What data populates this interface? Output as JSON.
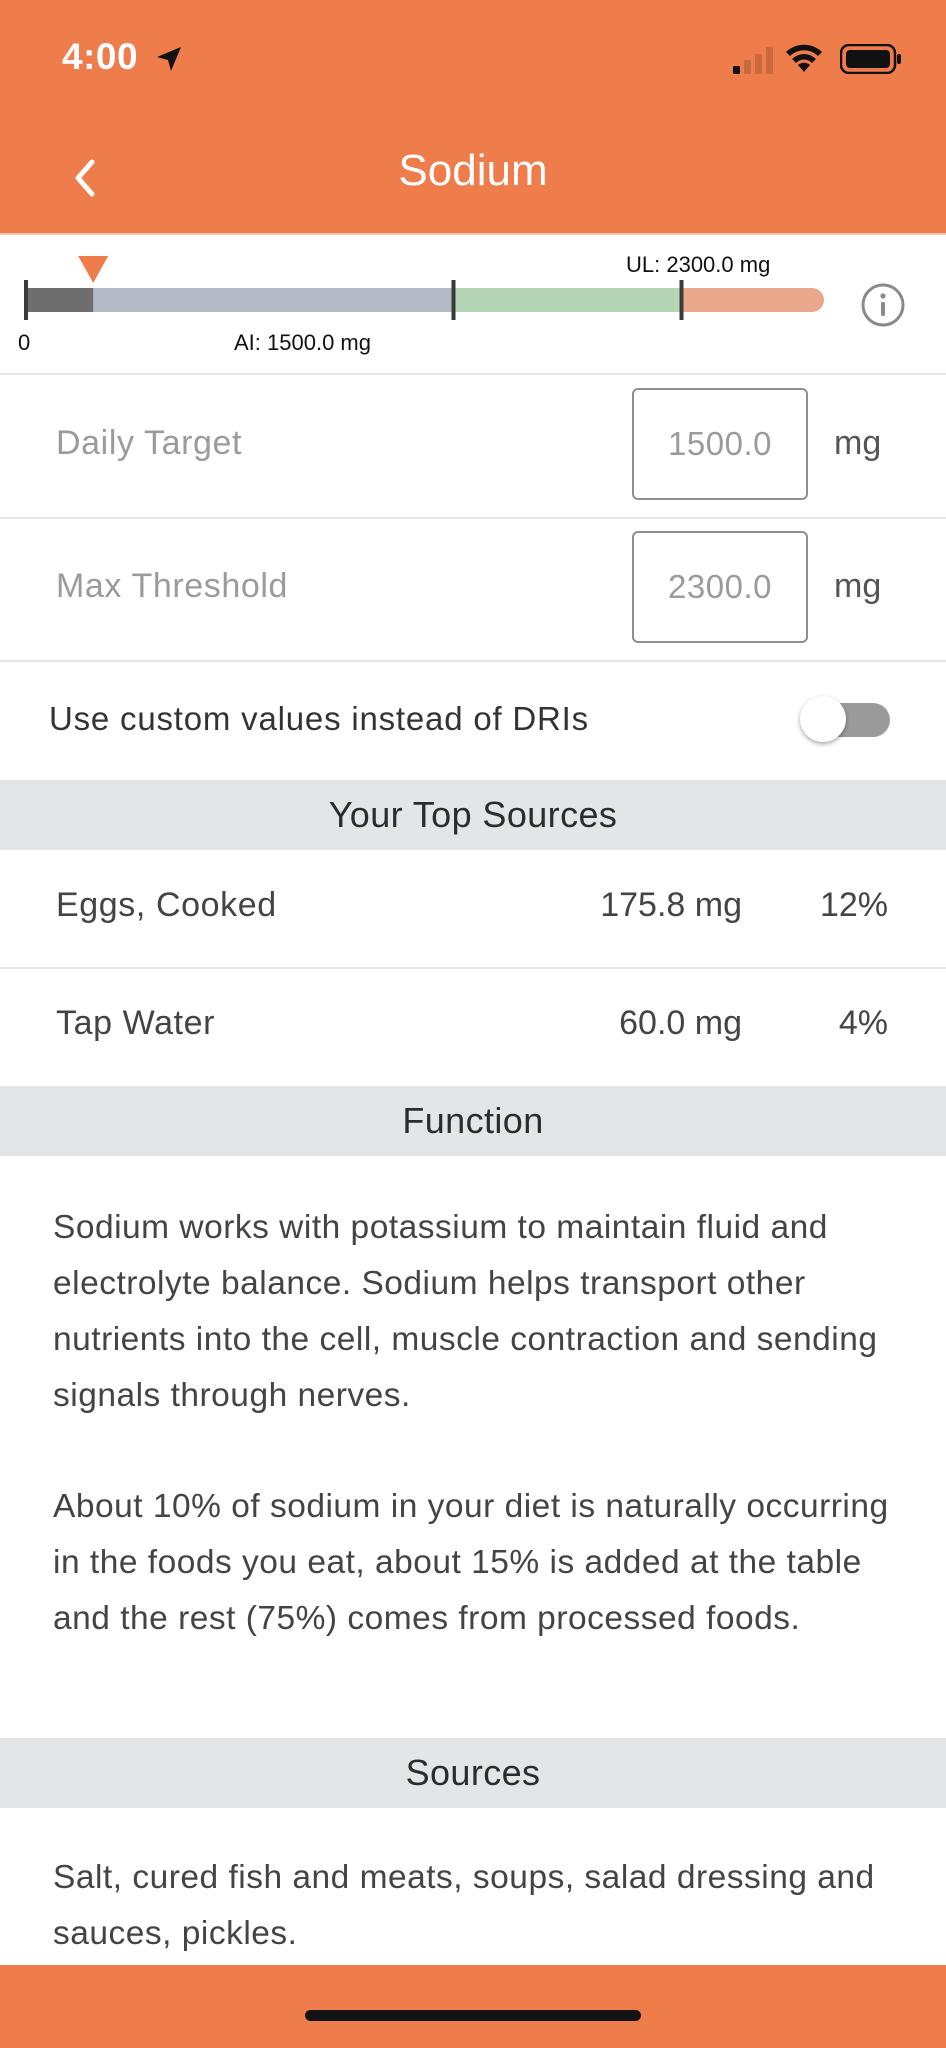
{
  "status": {
    "time": "4:00"
  },
  "header": {
    "title": "Sodium",
    "back_icon": "chevron-left-icon"
  },
  "range": {
    "zero_label": "0",
    "ai_label": "AI: 1500.0 mg",
    "ul_label": "UL: 2300.0 mg",
    "scale_max": 2800,
    "ai": 1500,
    "ul": 2300,
    "current": 235.8,
    "colors": {
      "below": "#b3bcc6",
      "adequate": "#b5d6b6",
      "over": "#e9a98a",
      "consumed": "#6e6e6e",
      "marker": "#EE7D4B"
    }
  },
  "daily_target": {
    "label": "Daily Target",
    "value": "1500.0",
    "unit": "mg"
  },
  "max_threshold": {
    "label": "Max Threshold",
    "value": "2300.0",
    "unit": "mg"
  },
  "custom_toggle": {
    "label": "Use custom values instead of DRIs",
    "on": false
  },
  "top_sources": {
    "heading": "Your Top Sources",
    "items": [
      {
        "name": "Eggs, Cooked",
        "amount": "175.8 mg",
        "percent": "12%"
      },
      {
        "name": "Tap Water",
        "amount": "60.0 mg",
        "percent": "4%"
      }
    ]
  },
  "function": {
    "heading": "Function",
    "paragraphs": [
      "Sodium works with potassium to maintain fluid and electrolyte balance. Sodium helps transport other nutrients into the cell, muscle contraction and sending signals through nerves.",
      "About 10% of sodium in your diet is naturally occurring in the foods you eat, about 15% is added at the table and the rest (75%) comes from processed foods."
    ]
  },
  "sources": {
    "heading": "Sources",
    "text": "Salt, cured fish and meats, soups, salad dressing and sauces, pickles."
  },
  "accent_color": "#EE7D4B"
}
